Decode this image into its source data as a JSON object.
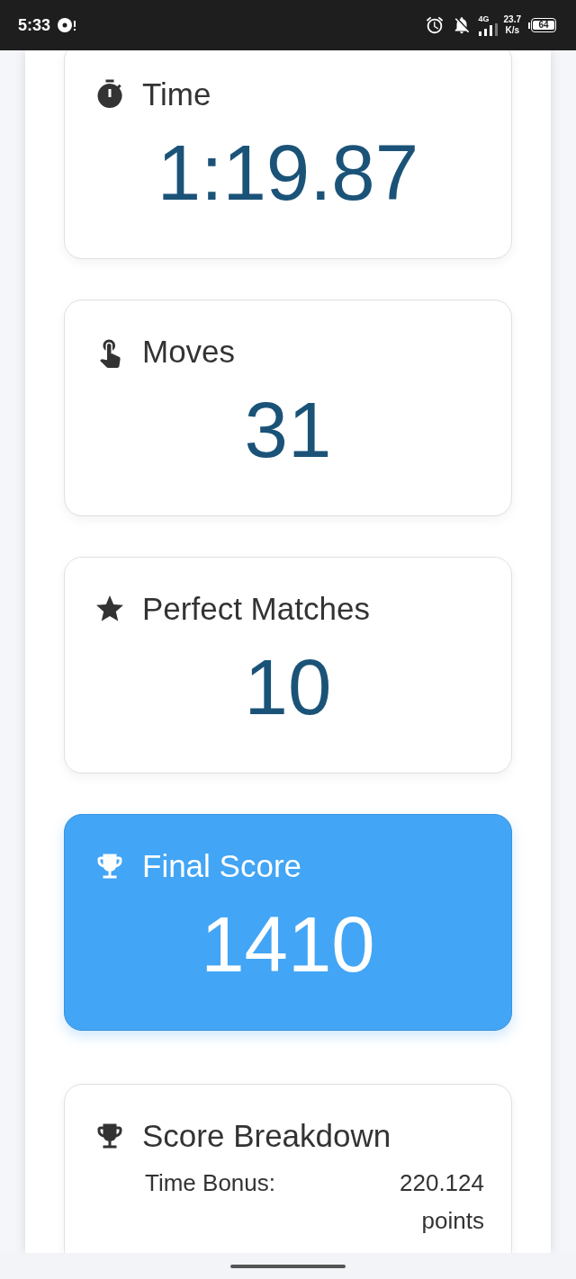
{
  "status_bar": {
    "time": "5:33",
    "network": "4G",
    "speed_value": "23.7",
    "speed_unit": "K/s",
    "battery": "64"
  },
  "stat_cards": [
    {
      "kind": "time",
      "title": "Time",
      "value": "1:19.87",
      "highlighted": false
    },
    {
      "kind": "moves",
      "title": "Moves",
      "value": "31",
      "highlighted": false
    },
    {
      "kind": "matches",
      "title": "Perfect Matches",
      "value": "10",
      "highlighted": false
    },
    {
      "kind": "score",
      "title": "Final Score",
      "value": "1410",
      "highlighted": true
    }
  ],
  "score_breakdown": {
    "title": "Score Breakdown",
    "rows": [
      {
        "label": "Time Bonus:",
        "value": "220.124 points"
      }
    ]
  }
}
